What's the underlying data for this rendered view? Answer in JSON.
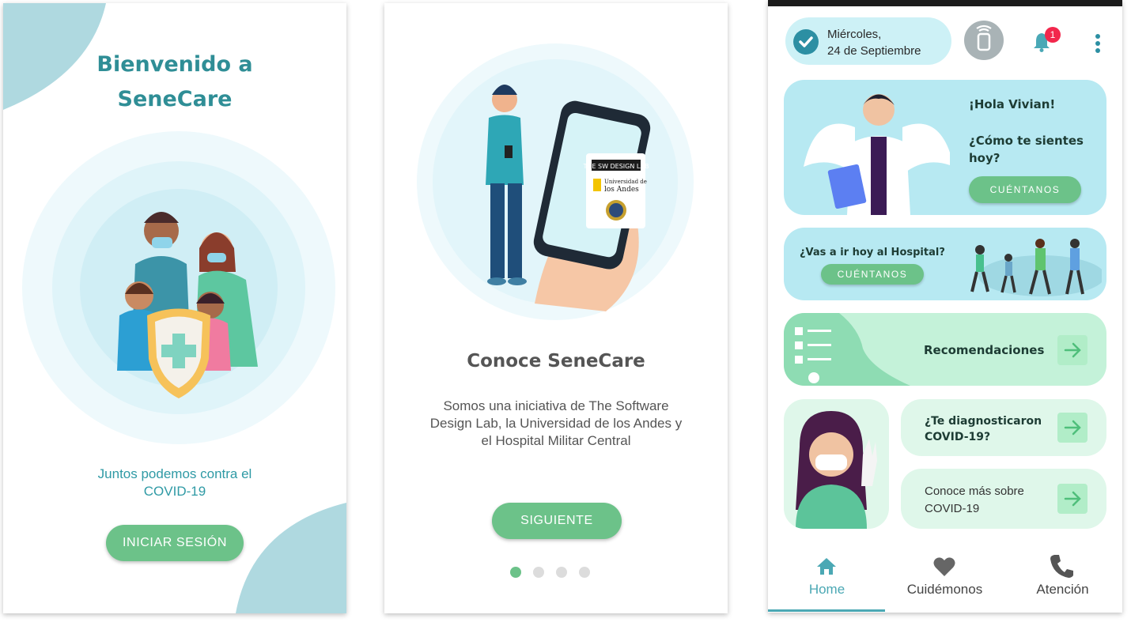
{
  "welcome": {
    "title_line1": "Bienvenido a",
    "title_line2": "SeneCare",
    "subtitle_line1": "Juntos podemos contra el",
    "subtitle_line2": "COVID-19",
    "login_button": "INICIAR SESIÓN"
  },
  "intro": {
    "title": "Conoce SeneCare",
    "description_line1": "Somos una iniciativa de The Software",
    "description_line2": "Design Lab, la Universidad de los Andes y",
    "description_line3": "el Hospital Militar Central",
    "next_button": "SIGUIENTE",
    "page_index": 1,
    "page_count": 4,
    "phone_logo_1": "THE SW DESIGN LAB",
    "phone_logo_2a": "Universidad de",
    "phone_logo_2b": "los Andes"
  },
  "home": {
    "date_line1": "Miércoles,",
    "date_line2": "24 de Septiembre",
    "notification_count": "1",
    "greeting": "¡Hola Vivian!",
    "question_line1": "¿Cómo te sientes",
    "question_line2": "hoy?",
    "tell_us_button": "CUÉNTANOS",
    "hospital_question": "¿Vas a ir hoy al Hospital?",
    "hospital_button": "CUÉNTANOS",
    "recommendations": "Recomendaciones",
    "diagnosed_line1": "¿Te diagnosticaron",
    "diagnosed_line2": "COVID-19?",
    "learn_line1": "Conoce más sobre",
    "learn_line2": "COVID-19",
    "nav": [
      {
        "label": "Home",
        "icon": "home-icon",
        "active": true
      },
      {
        "label": "Cuidémonos",
        "icon": "heart-icon",
        "active": false
      },
      {
        "label": "Atención",
        "icon": "phone-icon",
        "active": false
      }
    ]
  },
  "colors": {
    "primary_teal": "#2f8e96",
    "button_green": "#6cc289",
    "light_blue": "#b7e9f2",
    "light_green": "#c4f2d9",
    "badge_red": "#f2274c"
  }
}
